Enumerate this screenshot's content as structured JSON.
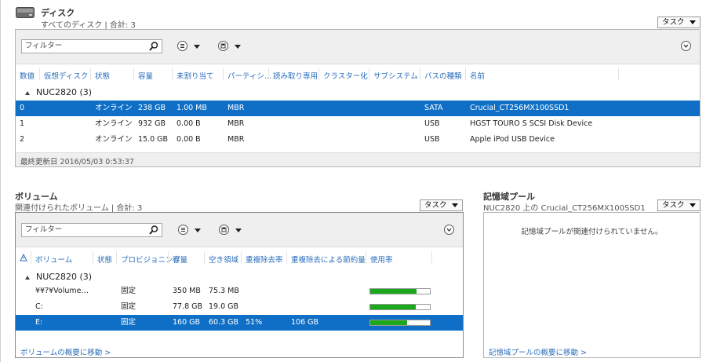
{
  "disk": {
    "title": "ディスク",
    "subtitle": "すべてのディスク | 合計: 3",
    "task_label": "タスク",
    "filter_placeholder": "フィルター",
    "columns": [
      "数値",
      "仮想ディスク",
      "状態",
      "容量",
      "未割り当て",
      "パーティシ…",
      "読み取り専用",
      "クラスター化",
      "サブシステム",
      "バスの種類",
      "名前"
    ],
    "group": "NUC2820 (3)",
    "rows": [
      {
        "num": "0",
        "state": "オンライン",
        "capacity": "238 GB",
        "unalloc": "1.00 MB",
        "partition": "MBR",
        "bus": "SATA",
        "name": "Crucial_CT256MX100SSD1",
        "selected": true
      },
      {
        "num": "1",
        "state": "オンライン",
        "capacity": "932 GB",
        "unalloc": "0.00 B",
        "partition": "MBR",
        "bus": "USB",
        "name": "HGST TOURO S SCSI Disk Device",
        "selected": false
      },
      {
        "num": "2",
        "state": "オンライン",
        "capacity": "15.0 GB",
        "unalloc": "0.00 B",
        "partition": "MBR",
        "bus": "USB",
        "name": "Apple iPod USB Device",
        "selected": false
      }
    ],
    "footer": "最終更新日 2016/05/03 0:53:37"
  },
  "volume": {
    "title": "ボリューム",
    "subtitle": "関連付けられたボリューム | 合計: 3",
    "task_label": "タスク",
    "filter_placeholder": "フィルター",
    "columns": [
      "ボリューム",
      "状態",
      "プロビジョニング",
      "容量",
      "空き領域",
      "重複除去率",
      "重複除去による節約量",
      "使用率"
    ],
    "group": "NUC2820 (3)",
    "rows": [
      {
        "name": "¥¥?¥Volume…",
        "provisioning": "固定",
        "capacity": "350 MB",
        "free": "75.3 MB",
        "dedup_rate": "",
        "dedup_saved": "",
        "usage": 0.78,
        "selected": false
      },
      {
        "name": "C:",
        "provisioning": "固定",
        "capacity": "77.8 GB",
        "free": "19.0 GB",
        "dedup_rate": "",
        "dedup_saved": "",
        "usage": 0.76,
        "selected": false
      },
      {
        "name": "E:",
        "provisioning": "固定",
        "capacity": "160 GB",
        "free": "60.3 GB",
        "dedup_rate": "51%",
        "dedup_saved": "106 GB",
        "usage": 0.62,
        "selected": true
      }
    ],
    "footer_link": "ボリュームの概要に移動 >"
  },
  "pool": {
    "title": "記憶域プール",
    "subtitle": "NUC2820 上の Crucial_CT256MX100SSD1",
    "task_label": "タスク",
    "empty_message": "記憶域プールが関連付けられていません。",
    "footer_link": "記憶域プールの概要に移動 >"
  },
  "colors": {
    "accent": "#2a6ebc",
    "selection": "#0f6fc6",
    "usage_bar": "#1ca81c"
  }
}
